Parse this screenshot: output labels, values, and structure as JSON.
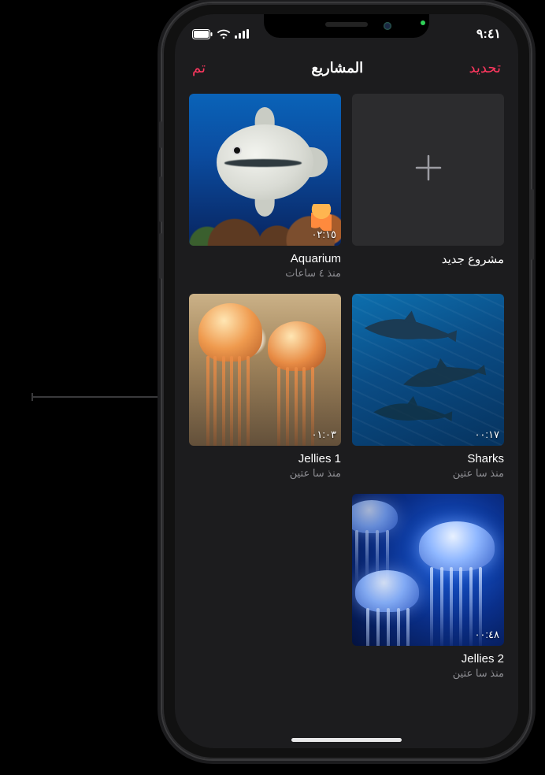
{
  "status": {
    "time": "٩:٤١",
    "cellular_icon": "cellular-bars-icon",
    "wifi_icon": "wifi-icon",
    "battery_icon": "battery-icon"
  },
  "header": {
    "title": "المشاريع",
    "select_label": "تحديد",
    "done_label": "تم"
  },
  "new_project": {
    "label": "مشروع جديد",
    "icon": "plus-icon"
  },
  "projects": [
    {
      "title": "Aquarium",
      "subtitle": "منذ ٤ ساعات",
      "duration": "٠٢:١٥",
      "thumb": "aquarium"
    },
    {
      "title": "Sharks",
      "subtitle": "منذ سا عتين",
      "duration": "٠٠:١٧",
      "thumb": "sharks"
    },
    {
      "title": "Jellies 1",
      "subtitle": "منذ سا عتين",
      "duration": "٠١:٠٣",
      "thumb": "jellies1"
    },
    {
      "title": "Jellies 2",
      "subtitle": "منذ سا عتين",
      "duration": "٠٠:٤٨",
      "thumb": "jellies2"
    }
  ]
}
